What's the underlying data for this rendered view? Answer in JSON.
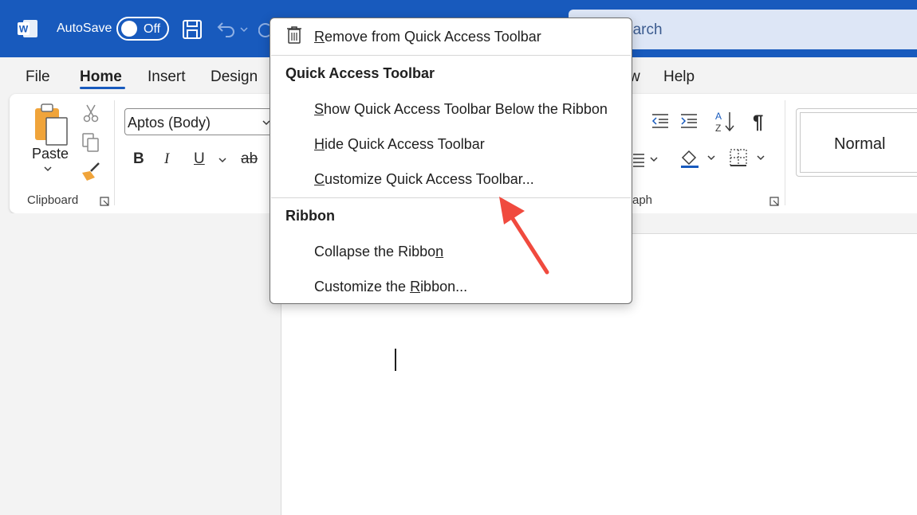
{
  "titlebar": {
    "autosave_label": "AutoSave",
    "toggle_state": "Off",
    "search_text": "earch",
    "brand_color": "#185abd"
  },
  "tabs": [
    {
      "label": "File"
    },
    {
      "label": "Home",
      "active": true
    },
    {
      "label": "Insert"
    },
    {
      "label": "Design"
    },
    {
      "label": "w"
    },
    {
      "label": "Help"
    }
  ],
  "ribbon": {
    "paste_label": "Paste",
    "clipboard_label": "Clipboard",
    "font_name": "Aptos (Body)",
    "bold": "B",
    "italic": "I",
    "underline": "U",
    "strike": "ab",
    "paragraph_label": "aph",
    "style_normal": "Normal",
    "pilcrow": "¶"
  },
  "context_menu": {
    "remove": {
      "before": "",
      "mnemonic": "R",
      "after": "emove from Quick Access Toolbar"
    },
    "section_qat": "Quick Access Toolbar",
    "show_below": {
      "before": "",
      "mnemonic": "S",
      "after": "how Quick Access Toolbar Below the Ribbon"
    },
    "hide": {
      "before": "",
      "mnemonic": "H",
      "after": "ide Quick Access Toolbar"
    },
    "customize_qat": {
      "before": "",
      "mnemonic": "C",
      "after": "ustomize Quick Access Toolbar..."
    },
    "section_ribbon": "Ribbon",
    "collapse": {
      "before": "Collapse the Ribbo",
      "mnemonic": "n",
      "after": ""
    },
    "customize_ribbon": {
      "before": "Customize the ",
      "mnemonic": "R",
      "after": "ibbon..."
    }
  },
  "annotation": {
    "arrow_color": "#f04a3e"
  }
}
